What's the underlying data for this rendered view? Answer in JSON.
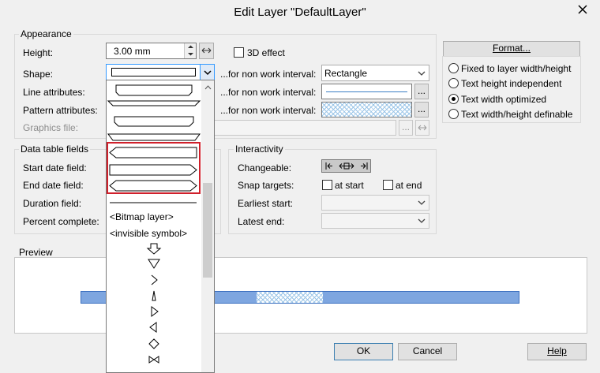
{
  "window": {
    "title": "Edit Layer \"DefaultLayer\""
  },
  "appearance": {
    "group_title": "Appearance",
    "height_label": "Height:",
    "height_value": "3.00 mm",
    "effect_label": "3D effect",
    "shape_label": "Shape:",
    "line_attr_label": "Line attributes:",
    "pattern_attr_label": "Pattern attributes:",
    "graphics_file_label": "Graphics file:",
    "non_work_label": "...for non work interval:",
    "non_work_shape_value": "Rectangle",
    "ellipsis": "..."
  },
  "format": {
    "button_label": "Format...",
    "options": [
      {
        "label": "Fixed to layer width/height",
        "selected": false
      },
      {
        "label": "Text height independent",
        "selected": false
      },
      {
        "label": "Text width optimized",
        "selected": true
      },
      {
        "label": "Text width/height definable",
        "selected": false
      }
    ]
  },
  "data_table": {
    "group_title": "Data table fields",
    "start_label": "Start date field:",
    "end_label": "End date field:",
    "duration_label": "Duration field:",
    "percent_label": "Percent complete:"
  },
  "interactivity": {
    "group_title": "Interactivity",
    "changeable_label": "Changeable:",
    "snap_label": "Snap targets:",
    "at_start_label": "at start",
    "at_end_label": "at end",
    "earliest_label": "Earliest start:",
    "latest_label": "Latest end:"
  },
  "preview": {
    "group_title": "Preview"
  },
  "dropdown": {
    "bitmap_item": "<Bitmap layer>",
    "invisible_item": "<invisible symbol>"
  },
  "buttons": {
    "ok": "OK",
    "cancel": "Cancel",
    "help": "Help"
  },
  "colors": {
    "bar_fill": "#7ea6e0",
    "bar_border": "#3b6fbf",
    "highlight_border": "#d0202b",
    "hatch": "#9cc6e8"
  }
}
